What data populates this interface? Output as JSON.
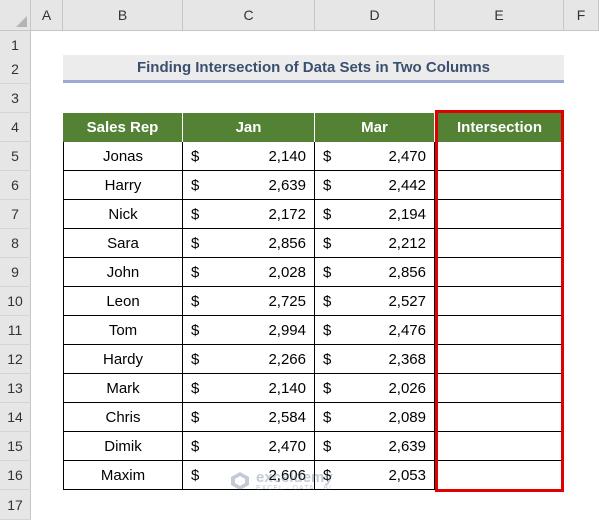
{
  "columns": [
    "A",
    "B",
    "C",
    "D",
    "E",
    "F"
  ],
  "rows": [
    "1",
    "2",
    "3",
    "4",
    "5",
    "6",
    "7",
    "8",
    "9",
    "10",
    "11",
    "12",
    "13",
    "14",
    "15",
    "16",
    "17"
  ],
  "title": "Finding Intersection of Data Sets in Two Columns",
  "table": {
    "headers": [
      "Sales Rep",
      "Jan",
      "Mar",
      "Intersection"
    ],
    "currency": "$",
    "records": [
      {
        "rep": "Jonas",
        "jan": "2,140",
        "mar": "2,470"
      },
      {
        "rep": "Harry",
        "jan": "2,639",
        "mar": "2,442"
      },
      {
        "rep": "Nick",
        "jan": "2,172",
        "mar": "2,194"
      },
      {
        "rep": "Sara",
        "jan": "2,856",
        "mar": "2,212"
      },
      {
        "rep": "John",
        "jan": "2,028",
        "mar": "2,856"
      },
      {
        "rep": "Leon",
        "jan": "2,725",
        "mar": "2,527"
      },
      {
        "rep": "Tom",
        "jan": "2,994",
        "mar": "2,476"
      },
      {
        "rep": "Hardy",
        "jan": "2,266",
        "mar": "2,368"
      },
      {
        "rep": "Mark",
        "jan": "2,140",
        "mar": "2,026"
      },
      {
        "rep": "Chris",
        "jan": "2,584",
        "mar": "2,089"
      },
      {
        "rep": "Dimik",
        "jan": "2,470",
        "mar": "2,639"
      },
      {
        "rep": "Maxim",
        "jan": "2,606",
        "mar": "2,053"
      }
    ]
  },
  "watermark": {
    "brand": "exceldemy",
    "tagline": "EXCEL · DATA · BI"
  },
  "colors": {
    "header_green": "#548235",
    "highlight_red": "#e00000",
    "title_underline": "#9aa9d6"
  }
}
